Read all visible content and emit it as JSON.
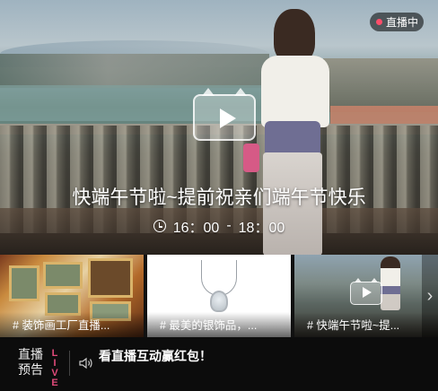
{
  "hero": {
    "badge": "直播中",
    "title": "快端午节啦~提前祝亲们端午节快乐",
    "time_start": "16：00",
    "time_sep": "-",
    "time_end": "18：00"
  },
  "thumbnails": [
    {
      "caption": "# 装饰画工厂直播..."
    },
    {
      "caption": "# 最美的银饰品，..."
    },
    {
      "caption": "# 快端午节啦~提..."
    }
  ],
  "footer": {
    "label": "直播预告",
    "live_letters": [
      "L",
      "I",
      "V",
      "E"
    ],
    "message": "看直播互动赢红包！"
  },
  "icons": {
    "badge_dot": "live-dot-icon",
    "clock": "clock-icon",
    "play": "play-icon",
    "next": "chevron-right-icon",
    "sound": "speaker-icon"
  },
  "colors": {
    "accent": "#ff4d6a",
    "live_text": "#e04a7a",
    "footer_bg": "#0c0c0c"
  }
}
